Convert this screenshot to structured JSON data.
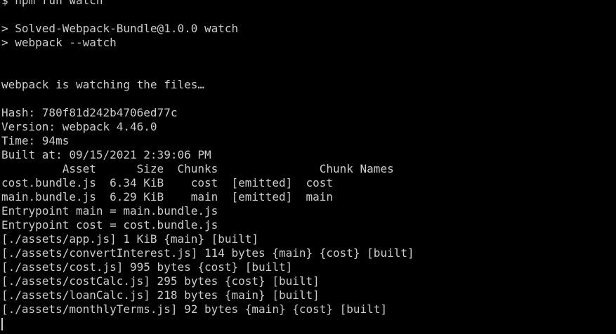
{
  "terminal": {
    "lines": [
      "$ npm run watch",
      "",
      "> Solved-Webpack-Bundle@1.0.0 watch",
      "> webpack --watch",
      "",
      "",
      "webpack is watching the files…",
      "",
      "Hash: 780f81d242b4706ed77c",
      "Version: webpack 4.46.0",
      "Time: 94ms",
      "Built at: 09/15/2021 2:39:06 PM",
      "         Asset      Size  Chunks               Chunk Names",
      "cost.bundle.js  6.34 KiB    cost  [emitted]  cost",
      "main.bundle.js  6.29 KiB    main  [emitted]  main",
      "Entrypoint main = main.bundle.js",
      "Entrypoint cost = cost.bundle.js",
      "[./assets/app.js] 1 KiB {main} [built]",
      "[./assets/convertInterest.js] 114 bytes {main} {cost} [built]",
      "[./assets/cost.js] 995 bytes {cost} [built]",
      "[./assets/costCalc.js] 295 bytes {cost} [built]",
      "[./assets/loanCalc.js] 218 bytes {main} [built]",
      "[./assets/monthlyTerms.js] 92 bytes {main} {cost} [built]"
    ]
  },
  "colors": {
    "background": "#000000",
    "foreground": "#cccccc"
  }
}
